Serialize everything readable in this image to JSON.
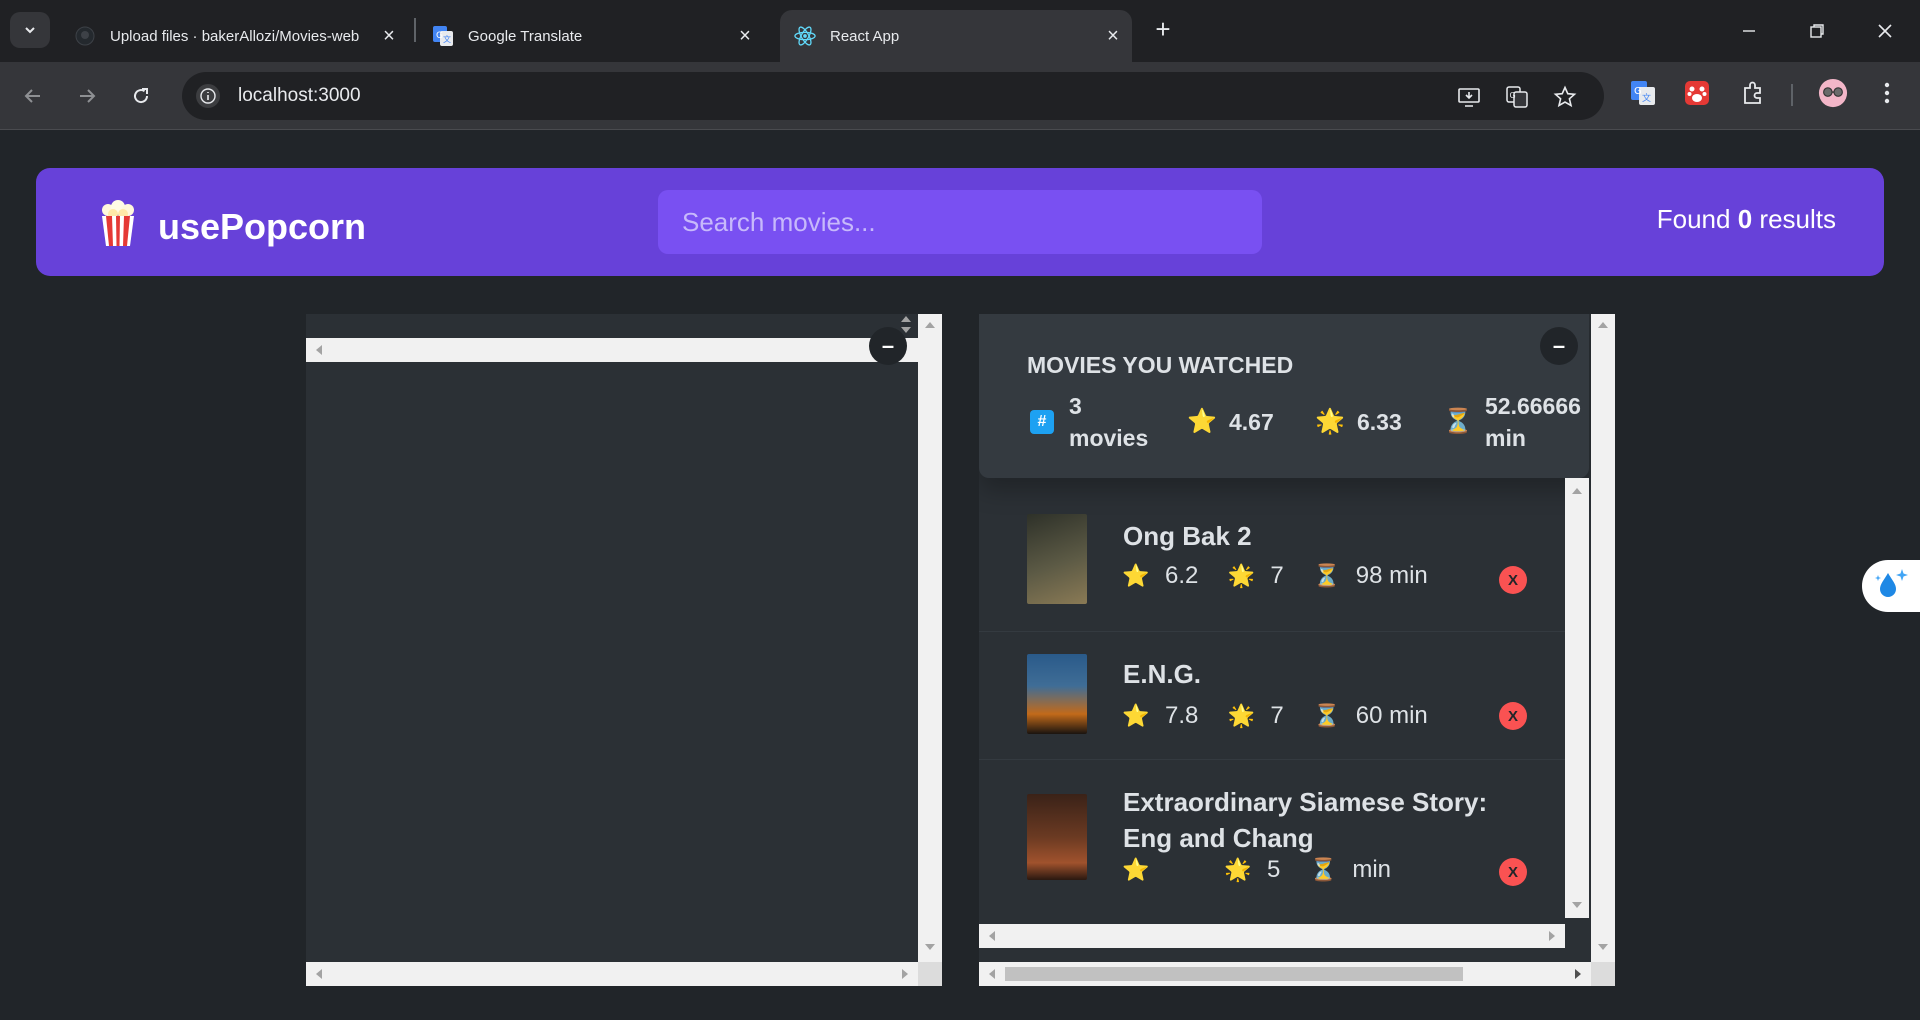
{
  "browser": {
    "tabs": [
      {
        "title": "Upload files · bakerAllozi/Movies-web",
        "favicon": "github-icon"
      },
      {
        "title": "Google Translate",
        "favicon": "google-translate-icon"
      },
      {
        "title": "React App",
        "favicon": "react-icon",
        "active": true
      }
    ],
    "url": "localhost:3000"
  },
  "app": {
    "logo_emoji": "🍿",
    "name": "usePopcorn",
    "search_placeholder": "Search movies...",
    "search_value": "",
    "results_prefix": "Found",
    "results_count": "0",
    "results_suffix": "results",
    "toggle_label": "–"
  },
  "watched_summary": {
    "heading": "MOVIES YOU WATCHED",
    "movies_count": "3",
    "movies_label": "movies",
    "avg_imdb_rating": "4.67",
    "avg_user_rating": "6.33",
    "avg_runtime": "52.66666",
    "runtime_unit": "min"
  },
  "watched_movies": [
    {
      "title": "Ong Bak 2",
      "imdb_rating": "6.2",
      "user_rating": "7",
      "runtime": "98 min",
      "poster_colors": [
        "#3a3d33",
        "#8a7a55"
      ]
    },
    {
      "title": "E.N.G.",
      "imdb_rating": "7.8",
      "user_rating": "7",
      "runtime": "60 min",
      "poster_colors": [
        "#2a5a8a",
        "#c26a1a"
      ]
    },
    {
      "title": "Extraordinary Siamese Story: Eng and Chang",
      "imdb_rating": "",
      "user_rating": "5",
      "runtime": "min",
      "poster_colors": [
        "#3a2218",
        "#a0522d"
      ]
    }
  ],
  "delete_label": "X",
  "colors": {
    "primary": "#6741d9",
    "primary_light": "#7950f2",
    "background": "#212529",
    "box": "#2b3035",
    "red": "#fa5252"
  }
}
